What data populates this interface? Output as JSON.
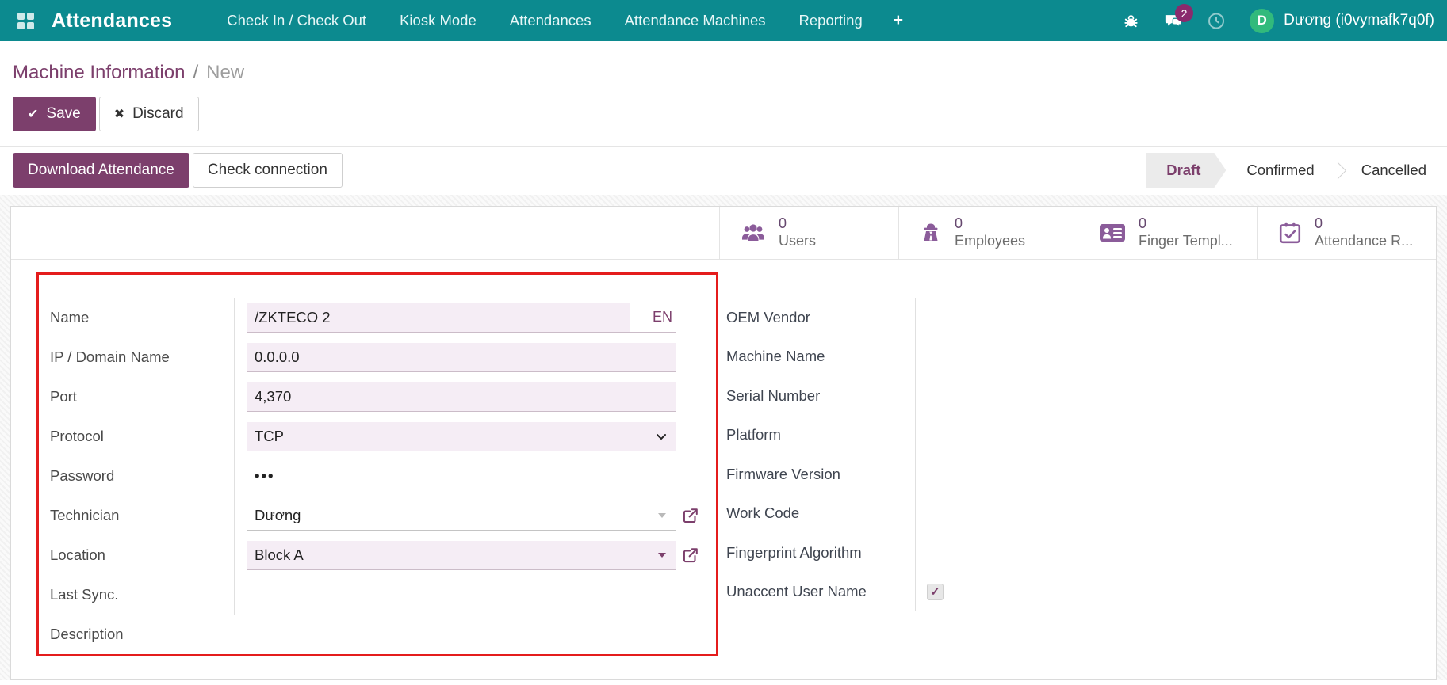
{
  "navbar": {
    "app_title": "Attendances",
    "menu_items": [
      "Check In / Check Out",
      "Kiosk Mode",
      "Attendances",
      "Attendance Machines",
      "Reporting"
    ],
    "plus_label": "+",
    "message_count": "2",
    "user": {
      "initial": "D",
      "name": "Dương (i0vymafk7q0f)"
    }
  },
  "breadcrumb": {
    "parent": "Machine Information",
    "separator": "/",
    "current": "New"
  },
  "controls": {
    "save_label": "Save",
    "discard_label": "Discard"
  },
  "action_buttons": {
    "download_label": "Download Attendance",
    "check_label": "Check connection"
  },
  "statusbar": {
    "active": "Draft",
    "states": [
      "Draft",
      "Confirmed",
      "Cancelled"
    ]
  },
  "stat_buttons": [
    {
      "icon": "users-icon",
      "value": "0",
      "label": "Users"
    },
    {
      "icon": "employee-icon",
      "value": "0",
      "label": "Employees"
    },
    {
      "icon": "id-card-icon",
      "value": "0",
      "label": "Finger Templ..."
    },
    {
      "icon": "calendar-check-icon",
      "value": "0",
      "label": "Attendance R..."
    }
  ],
  "form": {
    "left_rows": [
      {
        "label": "Name",
        "value": "/ZKTECO 2",
        "lang_badge": "EN"
      },
      {
        "label": "IP / Domain Name",
        "value": "0.0.0.0"
      },
      {
        "label": "Port",
        "value": "4,370"
      },
      {
        "label": "Protocol",
        "value": "TCP"
      },
      {
        "label": "Password",
        "value": "•••"
      },
      {
        "label": "Technician",
        "value": "Dương"
      },
      {
        "label": "Location",
        "value": "Block A"
      },
      {
        "label": "Last Sync.",
        "value": ""
      },
      {
        "label": "Description",
        "value": ""
      }
    ],
    "right_rows": [
      {
        "label": "OEM Vendor"
      },
      {
        "label": "Machine Name"
      },
      {
        "label": "Serial Number"
      },
      {
        "label": "Platform"
      },
      {
        "label": "Firmware Version"
      },
      {
        "label": "Work Code"
      },
      {
        "label": "Fingerprint Algorithm"
      },
      {
        "label": "Unaccent User Name",
        "checked": true
      }
    ]
  },
  "colors": {
    "navbar_teal": "#0c8a8f",
    "primary_purple": "#7c3f6c",
    "stat_icon_purple": "#8b5c9a",
    "input_pink": "#f5edf5",
    "annotation_red": "#e41c1c",
    "badge_magenta": "#8a2a6d",
    "avatar_green": "#32ba7c"
  }
}
